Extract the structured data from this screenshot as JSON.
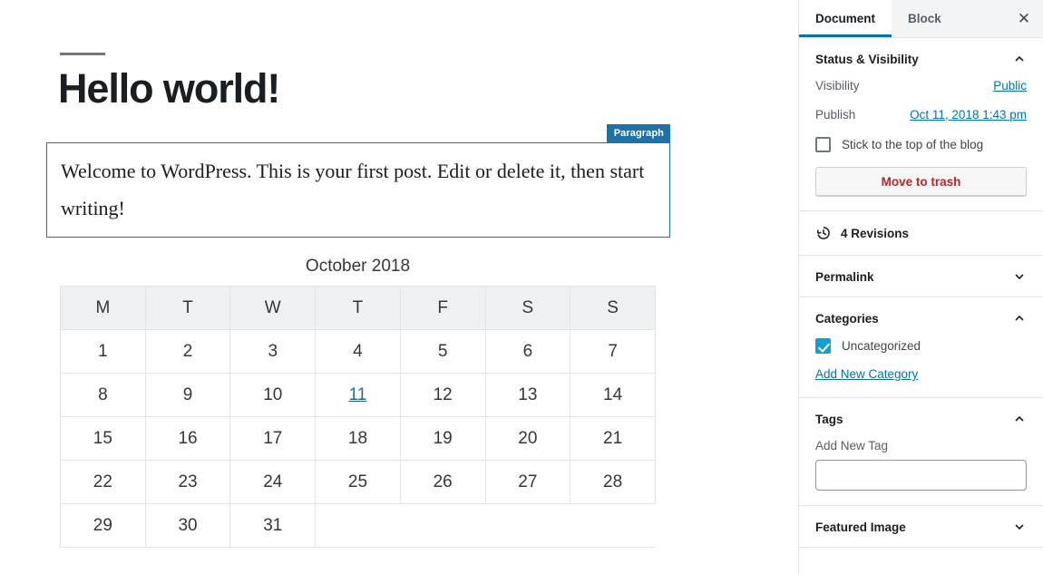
{
  "editor": {
    "post_title": "Hello world!",
    "block": {
      "badge": "Paragraph",
      "text": "Welcome to WordPress. This is your first post. Edit or delete it, then start writing!"
    },
    "calendar": {
      "caption": "October 2018",
      "weekdays": [
        "M",
        "T",
        "W",
        "T",
        "F",
        "S",
        "S"
      ],
      "weeks": [
        [
          "1",
          "2",
          "3",
          "4",
          "5",
          "6",
          "7"
        ],
        [
          "8",
          "9",
          "10",
          "11",
          "12",
          "13",
          "14"
        ],
        [
          "15",
          "16",
          "17",
          "18",
          "19",
          "20",
          "21"
        ],
        [
          "22",
          "23",
          "24",
          "25",
          "26",
          "27",
          "28"
        ],
        [
          "29",
          "30",
          "31",
          "",
          "",
          "",
          ""
        ]
      ],
      "linked_day": "11"
    }
  },
  "sidebar": {
    "tabs": [
      {
        "label": "Document",
        "active": true
      },
      {
        "label": "Block",
        "active": false
      }
    ],
    "close_label": "✕",
    "status_panel": {
      "title": "Status & Visibility",
      "visibility_label": "Visibility",
      "visibility_value": "Public",
      "publish_label": "Publish",
      "publish_value": "Oct 11, 2018 1:43 pm",
      "sticky_label": "Stick to the top of the blog",
      "sticky_checked": false,
      "trash_label": "Move to trash"
    },
    "revisions": {
      "label": "4 Revisions"
    },
    "permalink_panel": {
      "title": "Permalink"
    },
    "categories_panel": {
      "title": "Categories",
      "items": [
        {
          "label": "Uncategorized",
          "checked": true
        }
      ],
      "add_label": "Add New Category"
    },
    "tags_panel": {
      "title": "Tags",
      "field_label": "Add New Tag",
      "field_value": "",
      "field_placeholder": ""
    },
    "featured_panel": {
      "title": "Featured Image"
    }
  },
  "colors": {
    "accent": "#0073aa",
    "block_border": "#1e72a8",
    "badge_bg": "#1e72a8",
    "danger": "#b52727",
    "checkbox_checked": "#11a0d2",
    "panel_border": "#e2e4e7",
    "calendar_header_bg": "#eef0f1"
  }
}
